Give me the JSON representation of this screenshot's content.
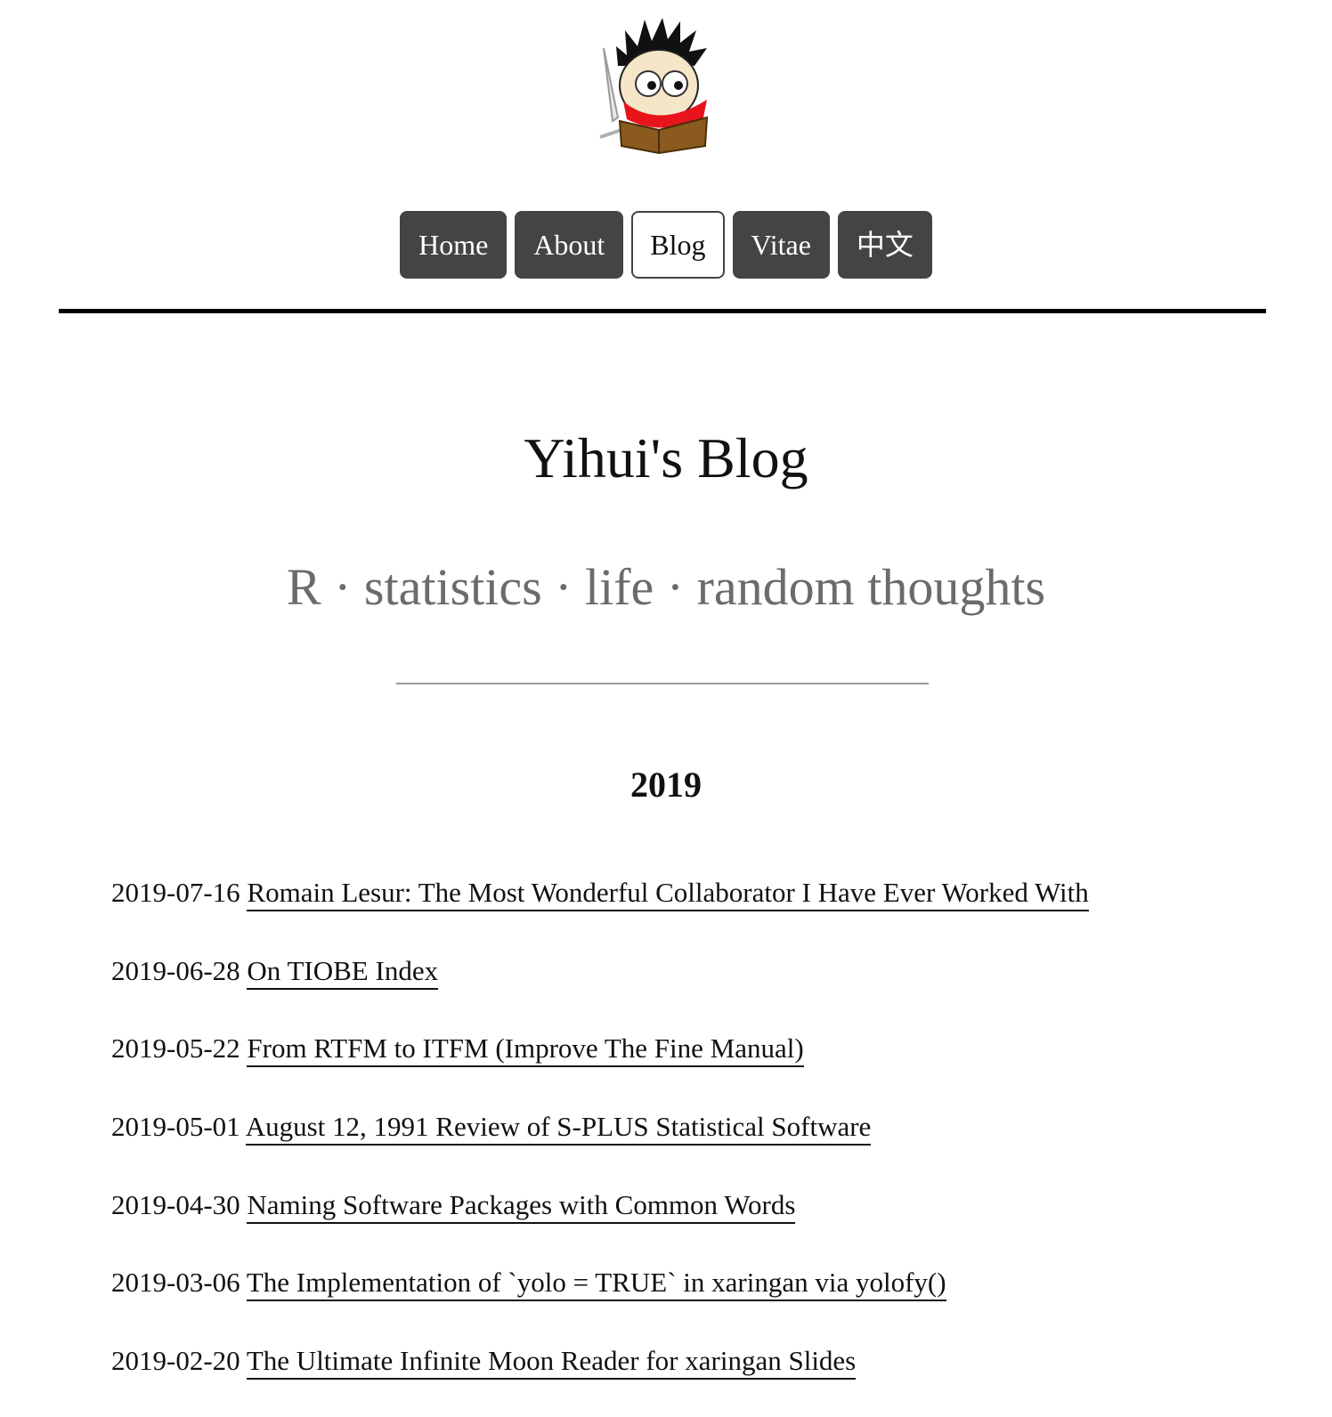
{
  "logo": {
    "icon": "reading-cartoon-avatar-icon"
  },
  "nav": {
    "items": [
      {
        "label": "Home",
        "active": false
      },
      {
        "label": "About",
        "active": false
      },
      {
        "label": "Blog",
        "active": true
      },
      {
        "label": "Vitae",
        "active": false
      },
      {
        "label": "中文",
        "active": false
      }
    ]
  },
  "header": {
    "title": "Yihui's Blog",
    "subtitle": "R · statistics · life · random thoughts"
  },
  "archive": {
    "year": "2019",
    "posts": [
      {
        "date": "2019-07-16",
        "title": "Romain Lesur: The Most Wonderful Collaborator I Have Ever Worked With"
      },
      {
        "date": "2019-06-28",
        "title": "On TIOBE Index"
      },
      {
        "date": "2019-05-22",
        "title": "From RTFM to ITFM (Improve The Fine Manual)"
      },
      {
        "date": "2019-05-01",
        "title": "August 12, 1991 Review of S-PLUS Statistical Software"
      },
      {
        "date": "2019-04-30",
        "title": "Naming Software Packages with Common Words"
      },
      {
        "date": "2019-03-06",
        "title": "The Implementation of `yolo = TRUE` in xaringan via yolofy()"
      },
      {
        "date": "2019-02-20",
        "title": "The Ultimate Infinite Moon Reader for xaringan Slides"
      }
    ]
  },
  "colors": {
    "nav_bg": "#444444",
    "nav_text": "#ffffff",
    "subtitle": "#6b6b6b",
    "link": "#111111"
  }
}
